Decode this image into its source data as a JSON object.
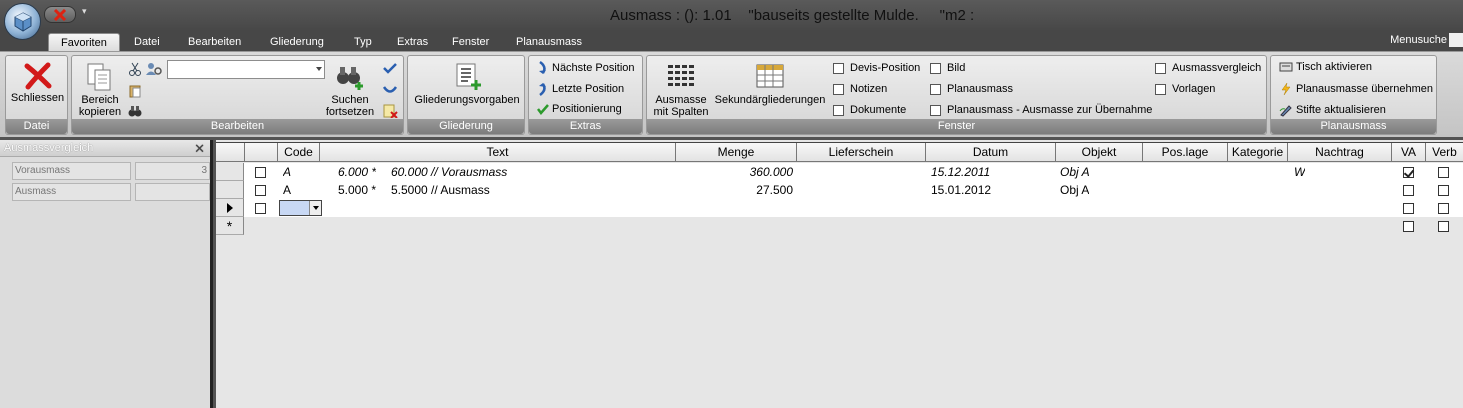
{
  "window": {
    "title": "Ausmass : (): 1.01    \"bauseits gestellte Mulde.     \"m2 :"
  },
  "tabs": [
    {
      "label": "Favoriten"
    },
    {
      "label": "Datei"
    },
    {
      "label": "Bearbeiten"
    },
    {
      "label": "Gliederung"
    },
    {
      "label": "Typ"
    },
    {
      "label": "Extras"
    },
    {
      "label": "Fenster"
    },
    {
      "label": "Planausmass"
    }
  ],
  "menusuche": "Menusuche",
  "ribbon": {
    "datei": {
      "label": "Datei",
      "schliessen": "Schliessen"
    },
    "bearbeiten": {
      "label": "Bearbeiten",
      "bereich_kopieren_1": "Bereich",
      "bereich_kopieren_2": "kopieren",
      "suchen_1": "Suchen",
      "suchen_2": "fortsetzen",
      "combo_value": ""
    },
    "gliederung": {
      "label": "Gliederung",
      "vorgaben": "Gliederungsvorgaben"
    },
    "extras": {
      "label": "Extras",
      "naechste": "Nächste Position",
      "letzte": "Letzte Position",
      "positionierung": "Positionierung"
    },
    "fenster": {
      "label": "Fenster",
      "ausmasse_1": "Ausmasse",
      "ausmasse_2": "mit Spalten",
      "sekundaer": "Sekundärgliederungen",
      "devis": "Devis-Position",
      "notizen": "Notizen",
      "dokumente": "Dokumente",
      "bild": "Bild",
      "planausmass": "Planausmass",
      "planausmass_uebernahme": "Planausmass - Ausmasse zur Übernahme",
      "ausmassvergleich": "Ausmassvergleich",
      "vorlagen": "Vorlagen"
    },
    "planausmass": {
      "label": "Planausmass",
      "tisch": "Tisch aktivieren",
      "uebernehmen": "Planausmasse übernehmen",
      "stifte": "Stifte aktualisieren"
    }
  },
  "sidebar": {
    "title": "Ausmassvergleich",
    "fields": [
      {
        "label": "Vorausmass",
        "value": "3"
      },
      {
        "label": "Ausmass",
        "value": ""
      }
    ]
  },
  "grid": {
    "columns": [
      "Code",
      "Text",
      "Menge",
      "Lieferschein",
      "Datum",
      "Objekt",
      "Pos.lage",
      "Kategorie",
      "Nachtrag",
      "VA",
      "Verb"
    ],
    "rows": [
      {
        "code": "A",
        "factor": "6.000 *",
        "text": "60.000 // Vorausmass",
        "menge": "360.000",
        "lieferschein": "",
        "datum": "15.12.2011",
        "objekt": "Obj A",
        "poslage": "",
        "kategorie": "",
        "nachtrag": "W",
        "va": true,
        "verb": false,
        "italic": true
      },
      {
        "code": "A",
        "factor": "5.000 *",
        "text": "5.5000 // Ausmass",
        "menge": "27.500",
        "lieferschein": "",
        "datum": "15.01.2012",
        "objekt": "Obj A",
        "poslage": "",
        "kategorie": "",
        "nachtrag": "",
        "va": false,
        "verb": false,
        "italic": false
      }
    ],
    "new_row_marker": "*"
  }
}
